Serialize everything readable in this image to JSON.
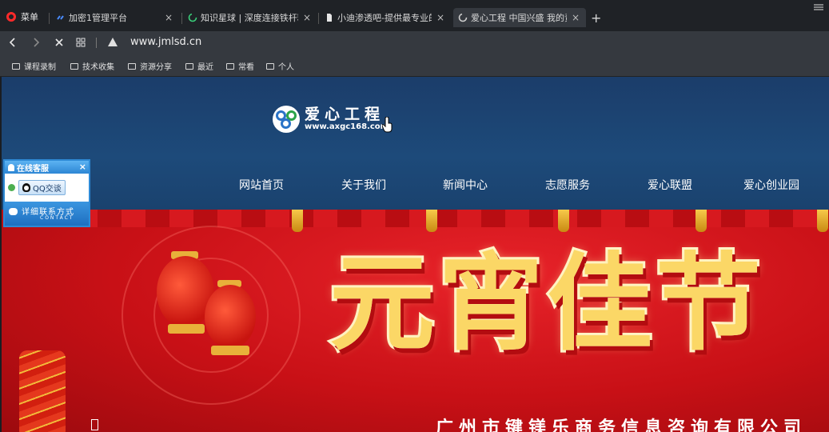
{
  "browser": {
    "menu_label": "菜单",
    "tabs": [
      {
        "title": "加密1管理平台",
        "icon": "link-icon"
      },
      {
        "title": "知识星球 | 深度连接铁杆粉",
        "icon": "loading-icon"
      },
      {
        "title": "小迪渗透吧-提供最专业的",
        "icon": "document-icon"
      },
      {
        "title": "爱心工程 中国兴盛 我的责",
        "icon": "loading-icon"
      }
    ],
    "close_glyph": "×",
    "new_tab_glyph": "+",
    "address": "www.jmlsd.cn",
    "bookmarks": [
      "课程录制",
      "技术收集",
      "资源分享",
      "最近",
      "常看",
      "个人"
    ]
  },
  "site": {
    "logo_title": "爱心工程",
    "logo_url": "www.axgc168.com",
    "nav": [
      "网站首页",
      "关于我们",
      "新闻中心",
      "志愿服务",
      "爱心联盟",
      "爱心创业园"
    ],
    "banner_title": "元宵佳节",
    "company": "广州市键镁乐商务信息咨询有限公司"
  },
  "chat_widget": {
    "title": "在线客服",
    "close_glyph": "×",
    "qq_button": "QQ交谈",
    "contact_label": "详细联系方式",
    "contact_sub": "CONTACT"
  },
  "colors": {
    "header": "#1d4a7a",
    "banner": "#c81016",
    "banner_text": "#fbd766",
    "chat": "#2e8ad6"
  }
}
